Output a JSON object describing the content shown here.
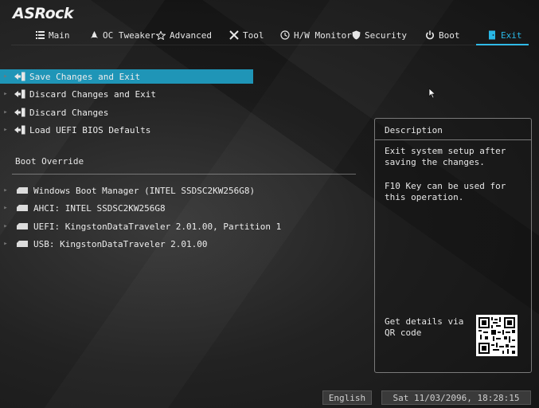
{
  "brand": "ASRock",
  "nav": {
    "tabs": [
      {
        "label": "Main",
        "icon": "list-icon",
        "active": false
      },
      {
        "label": "OC Tweaker",
        "icon": "rocket-icon",
        "active": false
      },
      {
        "label": "Advanced",
        "icon": "star-icon",
        "active": false
      },
      {
        "label": "Tool",
        "icon": "tools-icon",
        "active": false
      },
      {
        "label": "H/W Monitor",
        "icon": "monitor-icon",
        "active": false
      },
      {
        "label": "Security",
        "icon": "shield-icon",
        "active": false
      },
      {
        "label": "Boot",
        "icon": "power-icon",
        "active": false
      },
      {
        "label": "Exit",
        "icon": "exit-door-icon",
        "active": true
      }
    ],
    "accent_color": "#29b8e6"
  },
  "exit_menu": [
    {
      "label": "Save Changes and Exit",
      "selected": true
    },
    {
      "label": "Discard Changes and Exit",
      "selected": false
    },
    {
      "label": "Discard Changes",
      "selected": false
    },
    {
      "label": "Load UEFI BIOS Defaults",
      "selected": false
    }
  ],
  "boot_override": {
    "heading": "Boot Override",
    "items": [
      {
        "label": "Windows Boot Manager (INTEL SSDSC2KW256G8)"
      },
      {
        "label": "AHCI:  INTEL SSDSC2KW256G8"
      },
      {
        "label": "UEFI: KingstonDataTraveler 2.01.00, Partition 1"
      },
      {
        "label": "USB: KingstonDataTraveler 2.01.00"
      }
    ]
  },
  "description": {
    "title": "Description",
    "line1": "Exit system setup after saving the changes.",
    "line2": "F10 Key can be used for this operation.",
    "qr_label": "Get details via QR code"
  },
  "status": {
    "language": "English",
    "datetime": "Sat 11/03/2096, 18:28:15"
  },
  "colors": {
    "selected_bg": "#1f95b7",
    "panel_border": "#7a7a7a"
  }
}
